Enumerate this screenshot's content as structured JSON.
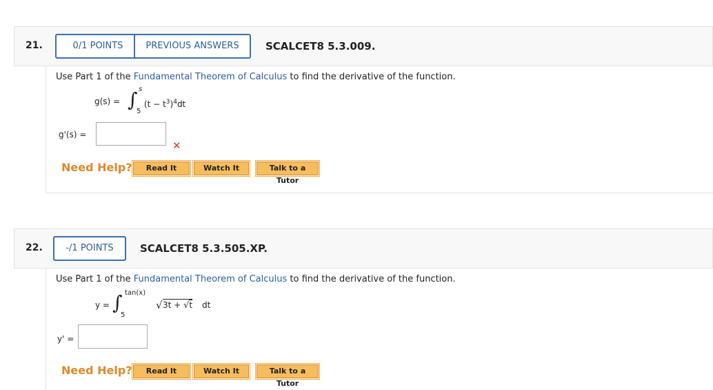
{
  "q21": {
    "number": "21.",
    "points": "0/1 POINTS",
    "previous_answers": "PREVIOUS ANSWERS",
    "code": "SCALCET8 5.3.009.",
    "prompt_before": "Use Part 1 of the ",
    "prompt_link": "Fundamental Theorem of Calculus",
    "prompt_after": " to find the derivative of the function.",
    "func_lhs": "g(s) =",
    "int_upper": "s",
    "int_lower": "5",
    "integrand_a": "(t − t",
    "integrand_sup1": "3",
    "integrand_b": ")",
    "integrand_sup2": "4",
    "integrand_c": "dt",
    "answer_label": "g'(s)  =",
    "answer_value": "",
    "result_icon": "incorrect-x-icon",
    "need_help": "Need Help?",
    "read_it": "Read It",
    "watch_it": "Watch It",
    "talk_tutor": "Talk to a Tutor"
  },
  "q22": {
    "number": "22.",
    "points": "-/1 POINTS",
    "code": "SCALCET8 5.3.505.XP.",
    "prompt_before": "Use Part 1 of the ",
    "prompt_link": "Fundamental Theorem of Calculus",
    "prompt_after": " to find the derivative of the function.",
    "func_lhs": "y =",
    "int_upper": "tan(x)",
    "int_lower": "5",
    "integrand": "3t + ",
    "integrand_inner_root": "t",
    "integrand_dt": " dt",
    "answer_label": "y' =",
    "answer_value": "",
    "need_help": "Need Help?",
    "read_it": "Read It",
    "watch_it": "Watch It",
    "talk_tutor": "Talk to a Tutor"
  },
  "colors": {
    "link": "#2a5f9e",
    "help": "#e0892b",
    "incorrect": "#e03030",
    "button": "#f6bd60"
  }
}
